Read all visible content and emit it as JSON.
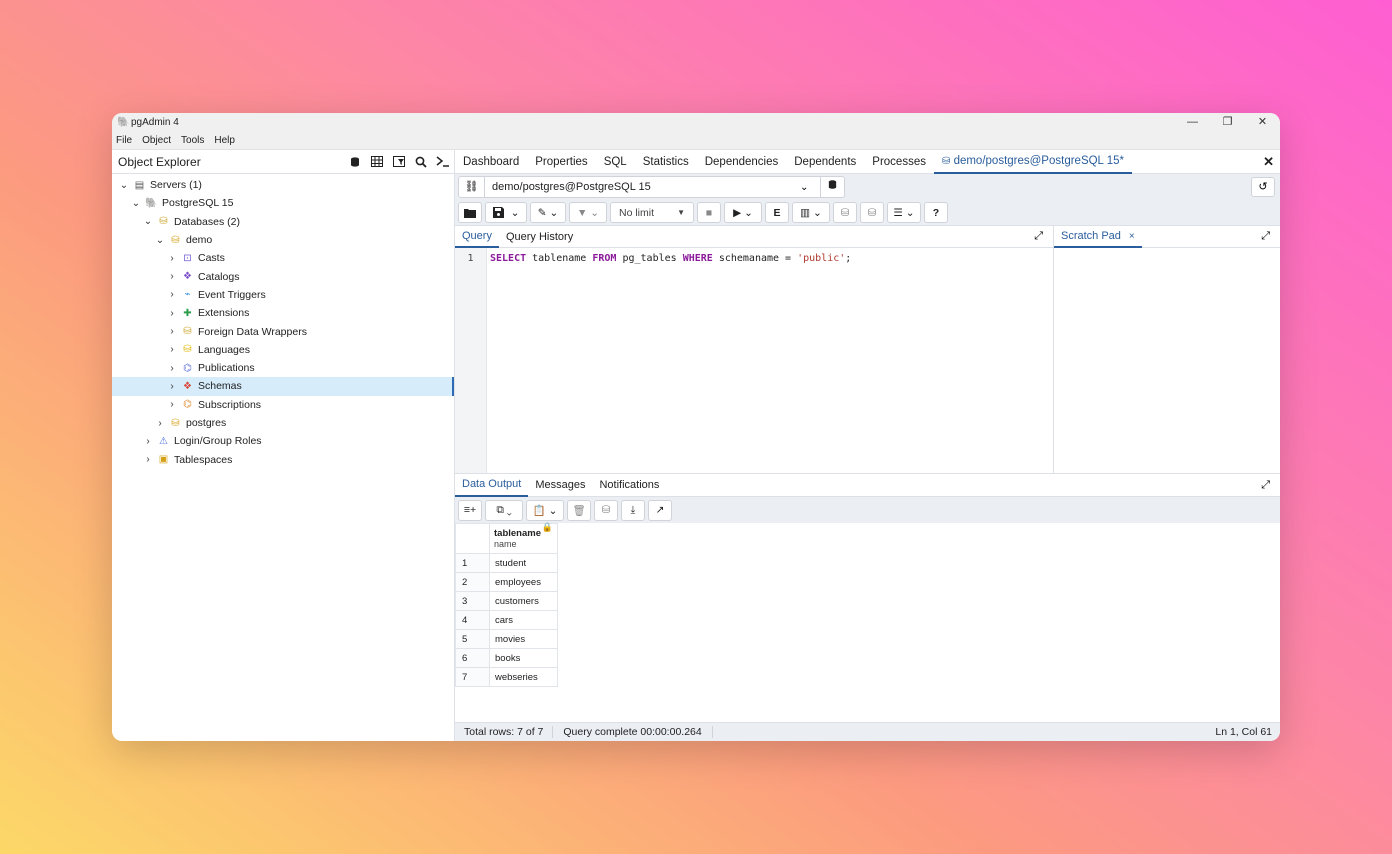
{
  "window": {
    "title": "pgAdmin 4",
    "minimize": "—",
    "restore": "❐",
    "close": "✕"
  },
  "menu": [
    "File",
    "Object",
    "Tools",
    "Help"
  ],
  "explorer": {
    "title": "Object Explorer",
    "tree": [
      {
        "label": "Servers (1)",
        "level": 0,
        "chev": "⌄",
        "icon": "servers-icon"
      },
      {
        "label": "PostgreSQL 15",
        "level": 1,
        "chev": "⌄",
        "icon": "postgres-elephant-icon"
      },
      {
        "label": "Databases (2)",
        "level": 2,
        "chev": "⌄",
        "icon": "databases-icon"
      },
      {
        "label": "demo",
        "level": 3,
        "chev": "⌄",
        "icon": "database-icon"
      },
      {
        "label": "Casts",
        "level": 4,
        "chev": "›",
        "icon": "casts-icon"
      },
      {
        "label": "Catalogs",
        "level": 4,
        "chev": "›",
        "icon": "catalogs-icon"
      },
      {
        "label": "Event Triggers",
        "level": 4,
        "chev": "›",
        "icon": "event-triggers-icon"
      },
      {
        "label": "Extensions",
        "level": 4,
        "chev": "›",
        "icon": "extensions-icon"
      },
      {
        "label": "Foreign Data Wrappers",
        "level": 4,
        "chev": "›",
        "icon": "fdw-icon"
      },
      {
        "label": "Languages",
        "level": 4,
        "chev": "›",
        "icon": "languages-icon"
      },
      {
        "label": "Publications",
        "level": 4,
        "chev": "›",
        "icon": "publications-icon"
      },
      {
        "label": "Schemas",
        "level": 4,
        "chev": "›",
        "icon": "schemas-icon",
        "selected": true
      },
      {
        "label": "Subscriptions",
        "level": 4,
        "chev": "›",
        "icon": "subscriptions-icon"
      },
      {
        "label": "postgres",
        "level": 3,
        "chev": "›",
        "icon": "database-icon"
      },
      {
        "label": "Login/Group Roles",
        "level": 2,
        "chev": "›",
        "icon": "roles-icon"
      },
      {
        "label": "Tablespaces",
        "level": 2,
        "chev": "›",
        "icon": "tablespaces-icon"
      }
    ]
  },
  "tabs": {
    "items": [
      "Dashboard",
      "Properties",
      "SQL",
      "Statistics",
      "Dependencies",
      "Dependents",
      "Processes"
    ],
    "active": "demo/postgres@PostgreSQL 15*",
    "close": "✕"
  },
  "connection": {
    "label": "demo/postgres@PostgreSQL 15"
  },
  "toolbar": {
    "limit": "No limit"
  },
  "query_tabs": {
    "query": "Query",
    "history": "Query History"
  },
  "editor": {
    "line_number": "1",
    "kw1": "SELECT",
    "t1": " tablename ",
    "kw2": "FROM",
    "t2": " pg_tables ",
    "kw3": "WHERE",
    "t3": " schemaname = ",
    "str": "'public'",
    "t4": ";"
  },
  "scratch": {
    "title": "Scratch Pad",
    "close": "×"
  },
  "output_tabs": {
    "data": "Data Output",
    "messages": "Messages",
    "notifications": "Notifications"
  },
  "grid": {
    "column": "tablename",
    "column_type": "name",
    "rows": [
      {
        "n": "1",
        "v": "student"
      },
      {
        "n": "2",
        "v": "employees"
      },
      {
        "n": "3",
        "v": "customers"
      },
      {
        "n": "4",
        "v": "cars"
      },
      {
        "n": "5",
        "v": "movies"
      },
      {
        "n": "6",
        "v": "books"
      },
      {
        "n": "7",
        "v": "webseries"
      }
    ]
  },
  "status": {
    "rows": "Total rows: 7 of 7",
    "query": "Query complete 00:00:00.264",
    "cursor": "Ln 1, Col 61"
  },
  "colors": {
    "accent": "#2a5d9c",
    "selected_row": "#d6ecfb",
    "keyword": "#8b1a9b",
    "string": "#b03a2e"
  }
}
